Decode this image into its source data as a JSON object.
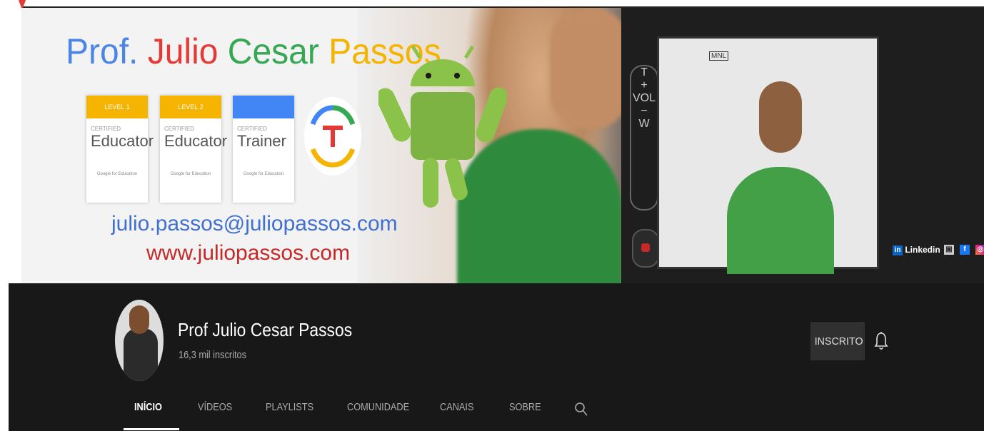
{
  "banner": {
    "title_parts": [
      "Prof.",
      "Julio",
      "Cesar",
      "Passos"
    ],
    "badges": [
      {
        "band": "LEVEL 1",
        "small": "CERTIFIED",
        "big": "Educator",
        "foot": "Google for Education",
        "band_color": "#f4b400"
      },
      {
        "band": "LEVEL 2",
        "small": "CERTIFIED",
        "big": "Educator",
        "foot": "Google for Education",
        "band_color": "#f4b400"
      },
      {
        "band": "",
        "small": "CERTIFIED",
        "big": "Trainer",
        "foot": "Google for Education",
        "band_color": "#4285f4"
      }
    ],
    "email": "julio.passos@juliopassos.com",
    "website": "www.juliopassos.com",
    "camera_screen_label": "MNL",
    "social": {
      "linkedin": "Linkedin"
    }
  },
  "channel": {
    "name": "Prof Julio Cesar Passos",
    "subscribers": "16,3 mil inscritos",
    "subscribe_label": "INSCRITO"
  },
  "tabs": [
    {
      "label": "INÍCIO",
      "active": true
    },
    {
      "label": "VÍDEOS",
      "active": false
    },
    {
      "label": "PLAYLISTS",
      "active": false
    },
    {
      "label": "COMUNIDADE",
      "active": false
    },
    {
      "label": "CANAIS",
      "active": false
    },
    {
      "label": "SOBRE",
      "active": false
    }
  ],
  "icons": {
    "bell": "bell-icon",
    "search": "search-icon"
  },
  "colors": {
    "bar_bg": "#181818",
    "brand_red": "#e53935",
    "brand_blue": "#4a86e8",
    "brand_green": "#34a853",
    "brand_yellow": "#f5b400"
  }
}
